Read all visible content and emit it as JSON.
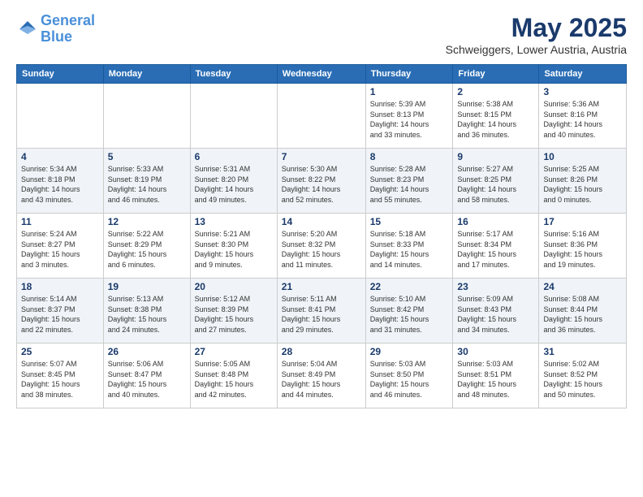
{
  "header": {
    "logo_line1": "General",
    "logo_line2": "Blue",
    "month_title": "May 2025",
    "subtitle": "Schweiggers, Lower Austria, Austria"
  },
  "weekdays": [
    "Sunday",
    "Monday",
    "Tuesday",
    "Wednesday",
    "Thursday",
    "Friday",
    "Saturday"
  ],
  "weeks": [
    [
      {
        "day": "",
        "info": ""
      },
      {
        "day": "",
        "info": ""
      },
      {
        "day": "",
        "info": ""
      },
      {
        "day": "",
        "info": ""
      },
      {
        "day": "1",
        "info": "Sunrise: 5:39 AM\nSunset: 8:13 PM\nDaylight: 14 hours\nand 33 minutes."
      },
      {
        "day": "2",
        "info": "Sunrise: 5:38 AM\nSunset: 8:15 PM\nDaylight: 14 hours\nand 36 minutes."
      },
      {
        "day": "3",
        "info": "Sunrise: 5:36 AM\nSunset: 8:16 PM\nDaylight: 14 hours\nand 40 minutes."
      }
    ],
    [
      {
        "day": "4",
        "info": "Sunrise: 5:34 AM\nSunset: 8:18 PM\nDaylight: 14 hours\nand 43 minutes."
      },
      {
        "day": "5",
        "info": "Sunrise: 5:33 AM\nSunset: 8:19 PM\nDaylight: 14 hours\nand 46 minutes."
      },
      {
        "day": "6",
        "info": "Sunrise: 5:31 AM\nSunset: 8:20 PM\nDaylight: 14 hours\nand 49 minutes."
      },
      {
        "day": "7",
        "info": "Sunrise: 5:30 AM\nSunset: 8:22 PM\nDaylight: 14 hours\nand 52 minutes."
      },
      {
        "day": "8",
        "info": "Sunrise: 5:28 AM\nSunset: 8:23 PM\nDaylight: 14 hours\nand 55 minutes."
      },
      {
        "day": "9",
        "info": "Sunrise: 5:27 AM\nSunset: 8:25 PM\nDaylight: 14 hours\nand 58 minutes."
      },
      {
        "day": "10",
        "info": "Sunrise: 5:25 AM\nSunset: 8:26 PM\nDaylight: 15 hours\nand 0 minutes."
      }
    ],
    [
      {
        "day": "11",
        "info": "Sunrise: 5:24 AM\nSunset: 8:27 PM\nDaylight: 15 hours\nand 3 minutes."
      },
      {
        "day": "12",
        "info": "Sunrise: 5:22 AM\nSunset: 8:29 PM\nDaylight: 15 hours\nand 6 minutes."
      },
      {
        "day": "13",
        "info": "Sunrise: 5:21 AM\nSunset: 8:30 PM\nDaylight: 15 hours\nand 9 minutes."
      },
      {
        "day": "14",
        "info": "Sunrise: 5:20 AM\nSunset: 8:32 PM\nDaylight: 15 hours\nand 11 minutes."
      },
      {
        "day": "15",
        "info": "Sunrise: 5:18 AM\nSunset: 8:33 PM\nDaylight: 15 hours\nand 14 minutes."
      },
      {
        "day": "16",
        "info": "Sunrise: 5:17 AM\nSunset: 8:34 PM\nDaylight: 15 hours\nand 17 minutes."
      },
      {
        "day": "17",
        "info": "Sunrise: 5:16 AM\nSunset: 8:36 PM\nDaylight: 15 hours\nand 19 minutes."
      }
    ],
    [
      {
        "day": "18",
        "info": "Sunrise: 5:14 AM\nSunset: 8:37 PM\nDaylight: 15 hours\nand 22 minutes."
      },
      {
        "day": "19",
        "info": "Sunrise: 5:13 AM\nSunset: 8:38 PM\nDaylight: 15 hours\nand 24 minutes."
      },
      {
        "day": "20",
        "info": "Sunrise: 5:12 AM\nSunset: 8:39 PM\nDaylight: 15 hours\nand 27 minutes."
      },
      {
        "day": "21",
        "info": "Sunrise: 5:11 AM\nSunset: 8:41 PM\nDaylight: 15 hours\nand 29 minutes."
      },
      {
        "day": "22",
        "info": "Sunrise: 5:10 AM\nSunset: 8:42 PM\nDaylight: 15 hours\nand 31 minutes."
      },
      {
        "day": "23",
        "info": "Sunrise: 5:09 AM\nSunset: 8:43 PM\nDaylight: 15 hours\nand 34 minutes."
      },
      {
        "day": "24",
        "info": "Sunrise: 5:08 AM\nSunset: 8:44 PM\nDaylight: 15 hours\nand 36 minutes."
      }
    ],
    [
      {
        "day": "25",
        "info": "Sunrise: 5:07 AM\nSunset: 8:45 PM\nDaylight: 15 hours\nand 38 minutes."
      },
      {
        "day": "26",
        "info": "Sunrise: 5:06 AM\nSunset: 8:47 PM\nDaylight: 15 hours\nand 40 minutes."
      },
      {
        "day": "27",
        "info": "Sunrise: 5:05 AM\nSunset: 8:48 PM\nDaylight: 15 hours\nand 42 minutes."
      },
      {
        "day": "28",
        "info": "Sunrise: 5:04 AM\nSunset: 8:49 PM\nDaylight: 15 hours\nand 44 minutes."
      },
      {
        "day": "29",
        "info": "Sunrise: 5:03 AM\nSunset: 8:50 PM\nDaylight: 15 hours\nand 46 minutes."
      },
      {
        "day": "30",
        "info": "Sunrise: 5:03 AM\nSunset: 8:51 PM\nDaylight: 15 hours\nand 48 minutes."
      },
      {
        "day": "31",
        "info": "Sunrise: 5:02 AM\nSunset: 8:52 PM\nDaylight: 15 hours\nand 50 minutes."
      }
    ]
  ]
}
